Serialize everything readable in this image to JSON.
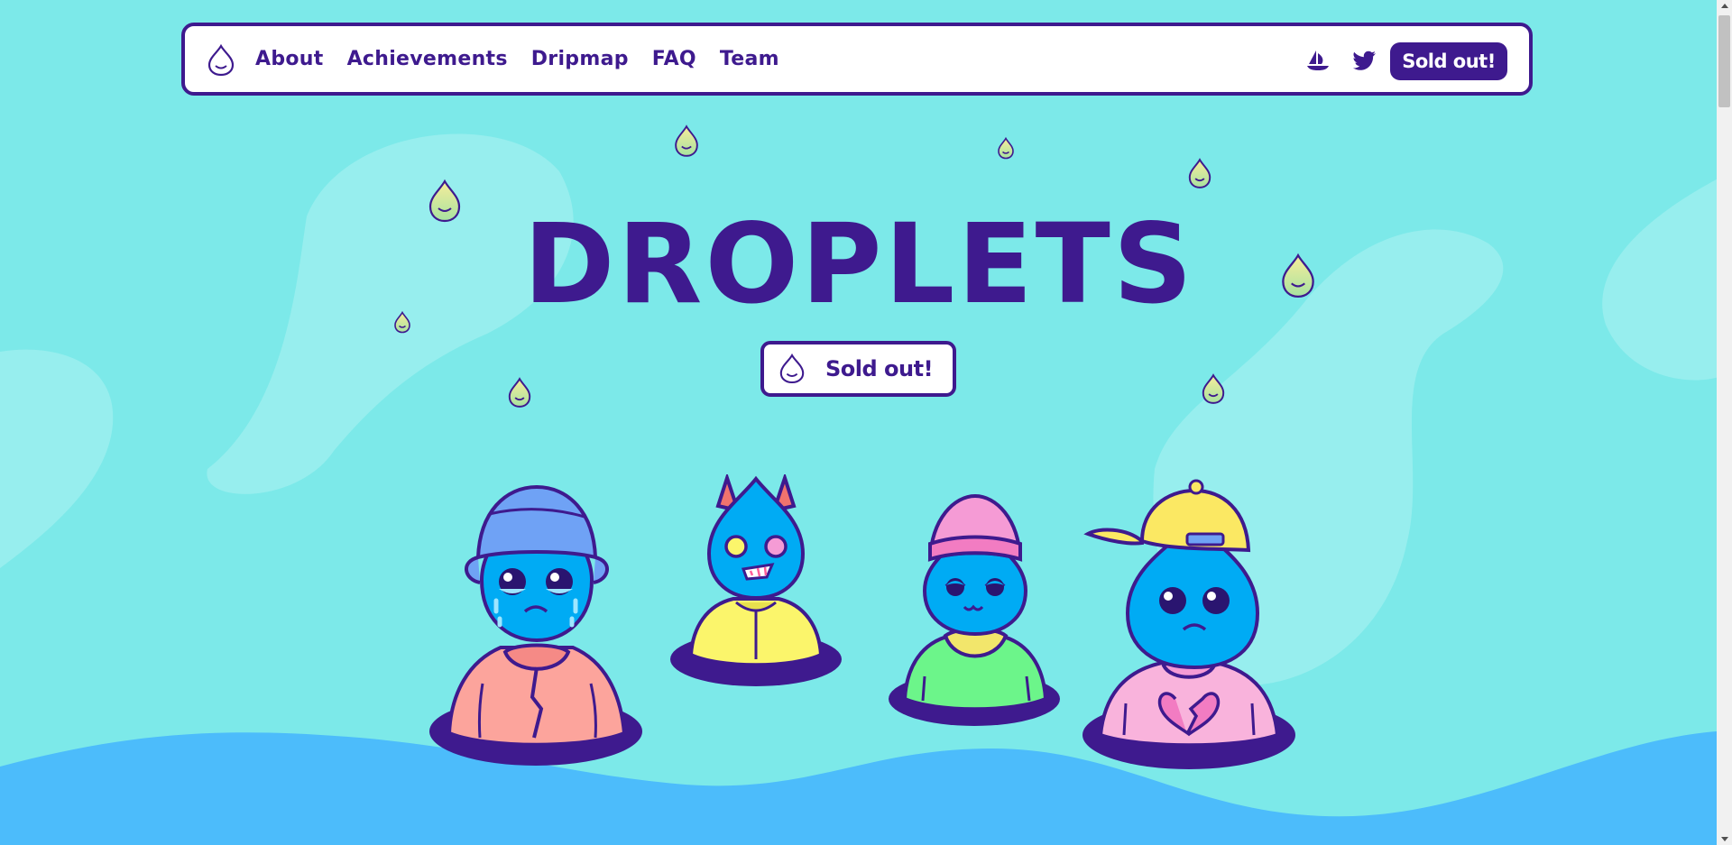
{
  "nav": {
    "logo_icon": "droplet-icon",
    "links": [
      "About",
      "Achievements",
      "Dripmap",
      "FAQ",
      "Team"
    ],
    "opensea_icon": "boat-icon",
    "twitter_icon": "twitter-bird-icon",
    "cta_label": "Sold out!"
  },
  "hero": {
    "title": "DROPLETS",
    "cta_label": "Sold out!",
    "cta_icon": "droplet-icon"
  },
  "colors": {
    "background": "#7ce9e9",
    "brand_purple": "#3e1a8e",
    "wave_blue": "#4cbcfb",
    "droplet_blue": "#00abf4"
  }
}
